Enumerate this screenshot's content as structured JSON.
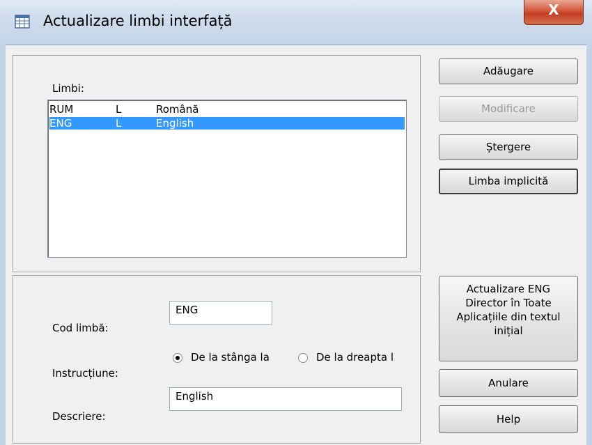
{
  "window": {
    "title": "Actualizare limbi interfață",
    "close_label": "X"
  },
  "languages": {
    "label": "Limbi:",
    "rows": [
      {
        "code": "RUM",
        "dir": "L",
        "name": "Română",
        "selected": false
      },
      {
        "code": "ENG",
        "dir": "L",
        "name": "English",
        "selected": true
      }
    ]
  },
  "form": {
    "code_label": "Cod limbă:",
    "code_value": "ENG",
    "direction_label": "Instrucțiune:",
    "ltr_label": "De la stânga la",
    "rtl_label": "De la dreapta l",
    "description_label": "Descriere:",
    "description_value": "English"
  },
  "buttons": {
    "add": "Adăugare",
    "modify": "Modificare",
    "delete": "Ștergere",
    "default": "Limba implicită",
    "update_line1": "Actualizare  ENG",
    "update_line2": "Director în Toate",
    "update_line3": "Aplicațiile din textul",
    "update_line4": "inițial",
    "cancel": "Anulare",
    "help": "Help"
  },
  "colors": {
    "selection": "#3399ff",
    "close": "#c13d24"
  }
}
